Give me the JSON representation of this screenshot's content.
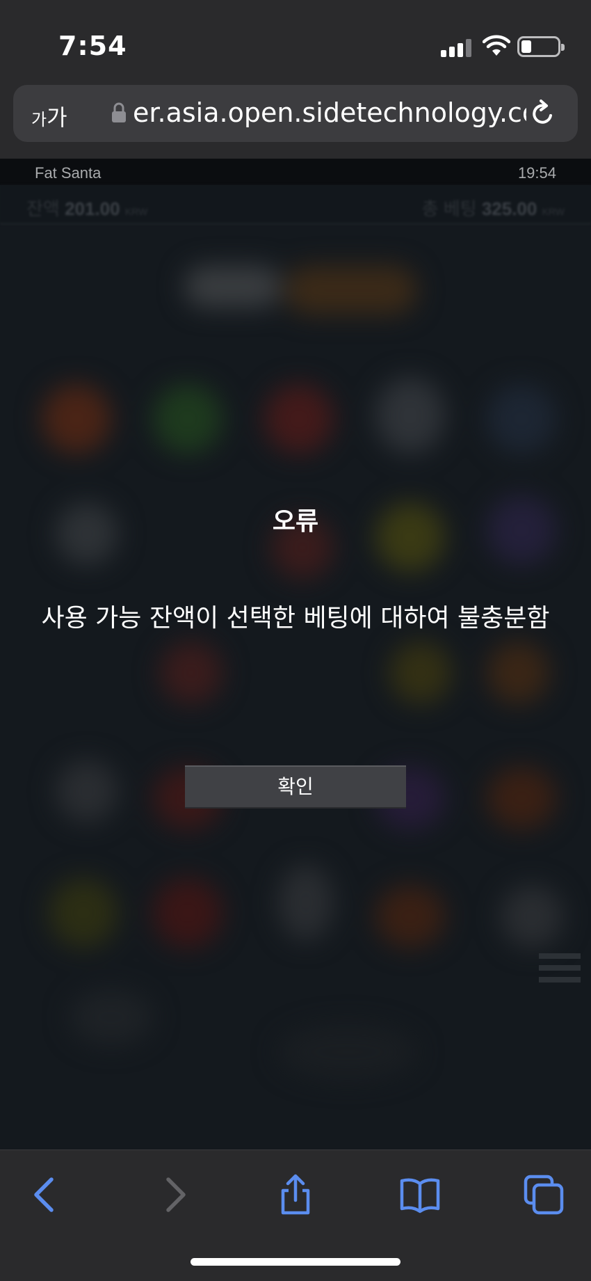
{
  "status_bar": {
    "time": "7:54",
    "icons": [
      "cellular-signal-icon",
      "wifi-icon",
      "battery-icon"
    ],
    "battery_level": 0.2
  },
  "browser": {
    "text_size_label_small": "가",
    "text_size_label_large": "가",
    "url": "er.asia.open.sidetechnology.co",
    "accent_color": "#5b8def"
  },
  "game": {
    "title": "Fat Santa",
    "clock": "19:54",
    "balance_label": "잔액",
    "balance_value": "201.00",
    "balance_currency": "KRW",
    "total_bet_label": "총 베팅",
    "total_bet_value": "325.00",
    "total_bet_currency": "KRW"
  },
  "dialog": {
    "title": "오류",
    "message": "사용 가능 잔액이 선택한 베팅에 대하여 불충분함",
    "confirm_label": "확인"
  },
  "toolbar": {
    "items": [
      "back-icon",
      "forward-icon",
      "share-icon",
      "bookmarks-icon",
      "tabs-icon"
    ]
  }
}
